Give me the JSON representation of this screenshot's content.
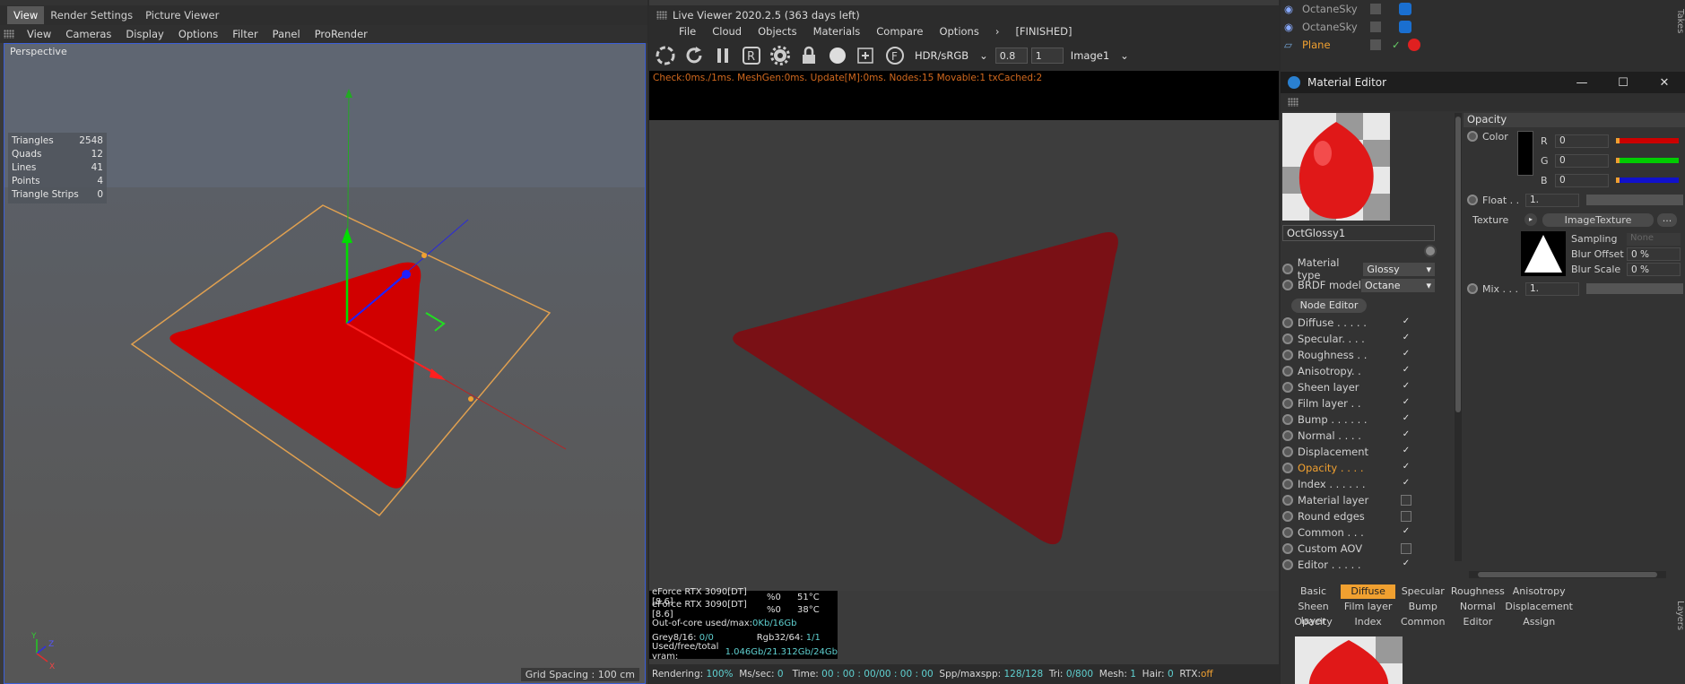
{
  "left_panel": {
    "tabs": [
      "View",
      "Render Settings",
      "Picture Viewer"
    ],
    "menu": [
      "View",
      "Cameras",
      "Display",
      "Options",
      "Filter",
      "Panel",
      "ProRender"
    ],
    "viewport_label": "Perspective",
    "stats": [
      {
        "label": "Triangles",
        "value": "2548"
      },
      {
        "label": "Quads",
        "value": "12"
      },
      {
        "label": "Lines",
        "value": "41"
      },
      {
        "label": "Points",
        "value": "4"
      },
      {
        "label": "Triangle Strips",
        "value": "0"
      }
    ],
    "grid_spacing": "Grid Spacing : 100 cm",
    "axis_labels": {
      "y": "Y",
      "z": "Z",
      "x": "X"
    }
  },
  "live_viewer": {
    "title": "Live Viewer 2020.2.5 (363 days left)",
    "menu": [
      "File",
      "Cloud",
      "Objects",
      "Materials",
      "Compare",
      "Options"
    ],
    "finished": "[FINISHED]",
    "colorspace": "HDR/sRGB",
    "exposure": "0.8",
    "samples": "1",
    "image_select": "Image1",
    "status_line": "Check:0ms./1ms. MeshGen:0ms. Update[M]:0ms. Nodes:15 Movable:1 txCached:2",
    "gpus": [
      {
        "name": "eForce RTX 3090[DT][8.6]",
        "load": "%0",
        "temp": "51°C"
      },
      {
        "name": "eForce RTX 3090[DT][8.6]",
        "load": "%0",
        "temp": "38°C"
      }
    ],
    "out_of_core_label": "Out-of-core used/max:",
    "out_of_core_value": "0Kb/16Gb",
    "grey_label": "Grey8/16:",
    "grey_value": "0/0",
    "rgb_label": "Rgb32/64:",
    "rgb_value": "1/1",
    "vram_label": "Used/free/total vram:",
    "vram_value": "1.046Gb/21.312Gb/24Gb",
    "bottom": {
      "rendering_label": "Rendering:",
      "rendering_value": "100%",
      "mssec_label": "Ms/sec:",
      "mssec_value": "0",
      "time_label": "Time:",
      "time_value": "00 : 00 : 00/00 : 00 : 00",
      "spp_label": "Spp/maxspp:",
      "spp_value": "128/128",
      "tri_label": "Tri:",
      "tri_value": "0/800",
      "mesh_label": "Mesh:",
      "mesh_value": "1",
      "hair_label": "Hair:",
      "hair_value": "0",
      "rtx_label": "RTX:",
      "rtx_value": "off"
    }
  },
  "objects": [
    {
      "name": "OctaneSky",
      "color": "#a0a0a0"
    },
    {
      "name": "OctaneSky",
      "color": "#a0a0a0"
    },
    {
      "name": "Plane",
      "color": "#f0a030"
    }
  ],
  "material_editor": {
    "title": "Material Editor",
    "material_name": "OctGlossy1",
    "material_type_label": "Material type",
    "material_type_value": "Glossy",
    "brdf_label": "BRDF model",
    "brdf_value": "Octane",
    "node_editor": "Node Editor",
    "channels": [
      {
        "label": "Diffuse . . . . .",
        "checked": true
      },
      {
        "label": "Specular. . . .",
        "checked": true
      },
      {
        "label": "Roughness . .",
        "checked": true
      },
      {
        "label": "Anisotropy. .",
        "checked": true
      },
      {
        "label": "Sheen layer",
        "checked": true
      },
      {
        "label": "Film layer . .",
        "checked": true
      },
      {
        "label": "Bump . . . . . .",
        "checked": true
      },
      {
        "label": "Normal . . . .",
        "checked": true
      },
      {
        "label": "Displacement",
        "checked": true
      },
      {
        "label": "Opacity . . . .",
        "checked": true,
        "active": true
      },
      {
        "label": "Index . . . . . .",
        "checked": true
      },
      {
        "label": "Material layer",
        "checked": false
      },
      {
        "label": "Round edges",
        "checked": false
      },
      {
        "label": "Common . . .",
        "checked": true
      },
      {
        "label": "Custom AOV",
        "checked": false
      },
      {
        "label": "Editor . . . . .",
        "checked": true
      }
    ],
    "opacity_section": "Opacity",
    "color_label": "Color",
    "r_label": "R",
    "r_value": "0",
    "g_label": "G",
    "g_value": "0",
    "b_label": "B",
    "b_value": "0",
    "float_label": "Float . .",
    "float_value": "1.",
    "texture_label": "Texture",
    "texture_button": "ImageTexture",
    "texture_more": "...",
    "sampling_label": "Sampling",
    "sampling_value": "None",
    "blur_offset_label": "Blur Offset",
    "blur_offset_value": "0 %",
    "blur_scale_label": "Blur Scale",
    "blur_scale_value": "0 %",
    "mix_label": "Mix . . .",
    "mix_value": "1.",
    "bottom_tabs": [
      "Basic",
      "Diffuse",
      "Specular",
      "Roughness",
      "Anisotropy",
      "Sheen layer",
      "Film layer",
      "Bump",
      "Normal",
      "Displacement",
      "Opacity",
      "Index",
      "Common",
      "Editor",
      "Assign"
    ],
    "active_tab": "Diffuse"
  },
  "side_labels": [
    "Takes",
    "Layers"
  ]
}
